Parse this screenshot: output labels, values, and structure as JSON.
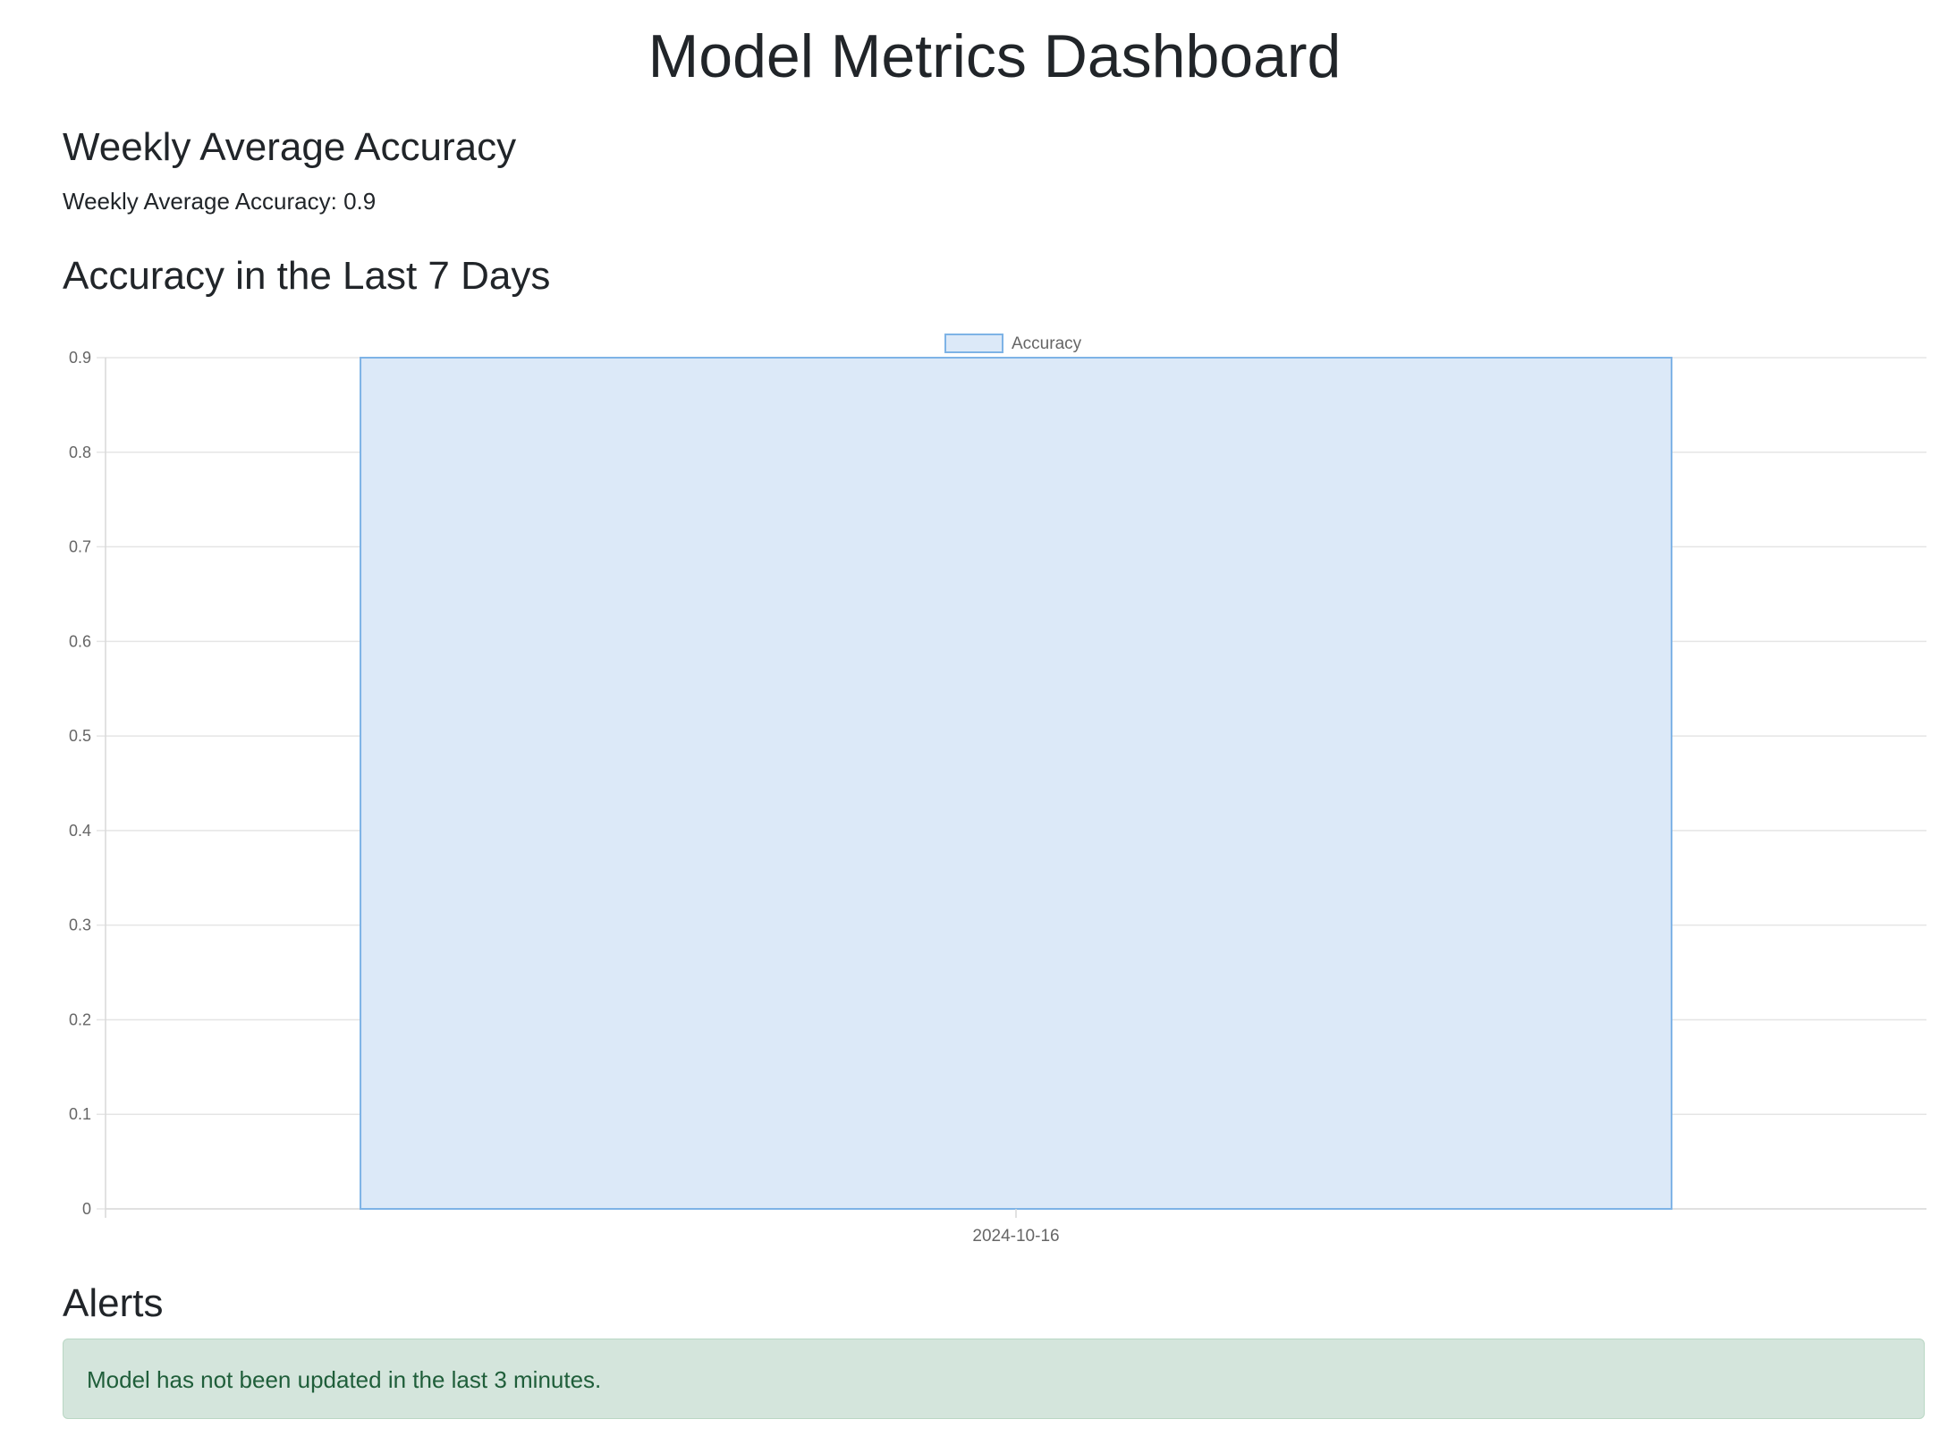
{
  "header": {
    "title": "Model Metrics Dashboard"
  },
  "weekly_average": {
    "heading": "Weekly Average Accuracy",
    "label": "Weekly Average Accuracy:",
    "value": "0.9"
  },
  "chart_section": {
    "heading": "Accuracy in the Last 7 Days"
  },
  "chart_data": {
    "type": "bar",
    "categories": [
      "2024-10-16"
    ],
    "series": [
      {
        "name": "Accuracy",
        "values": [
          0.9
        ],
        "color": "#dce9f8",
        "border_color": "#7eb3e6"
      }
    ],
    "ylim": [
      0,
      0.9
    ],
    "yticks": [
      "0",
      "0.1",
      "0.2",
      "0.3",
      "0.4",
      "0.5",
      "0.6",
      "0.7",
      "0.8",
      "0.9"
    ],
    "grid": true,
    "legend_position": "top-center"
  },
  "alerts": {
    "heading": "Alerts",
    "items": [
      {
        "text": "Model has not been updated in the last 3 minutes.",
        "color": "#d4e5dc",
        "text_color": "#1f5e3a"
      }
    ]
  }
}
